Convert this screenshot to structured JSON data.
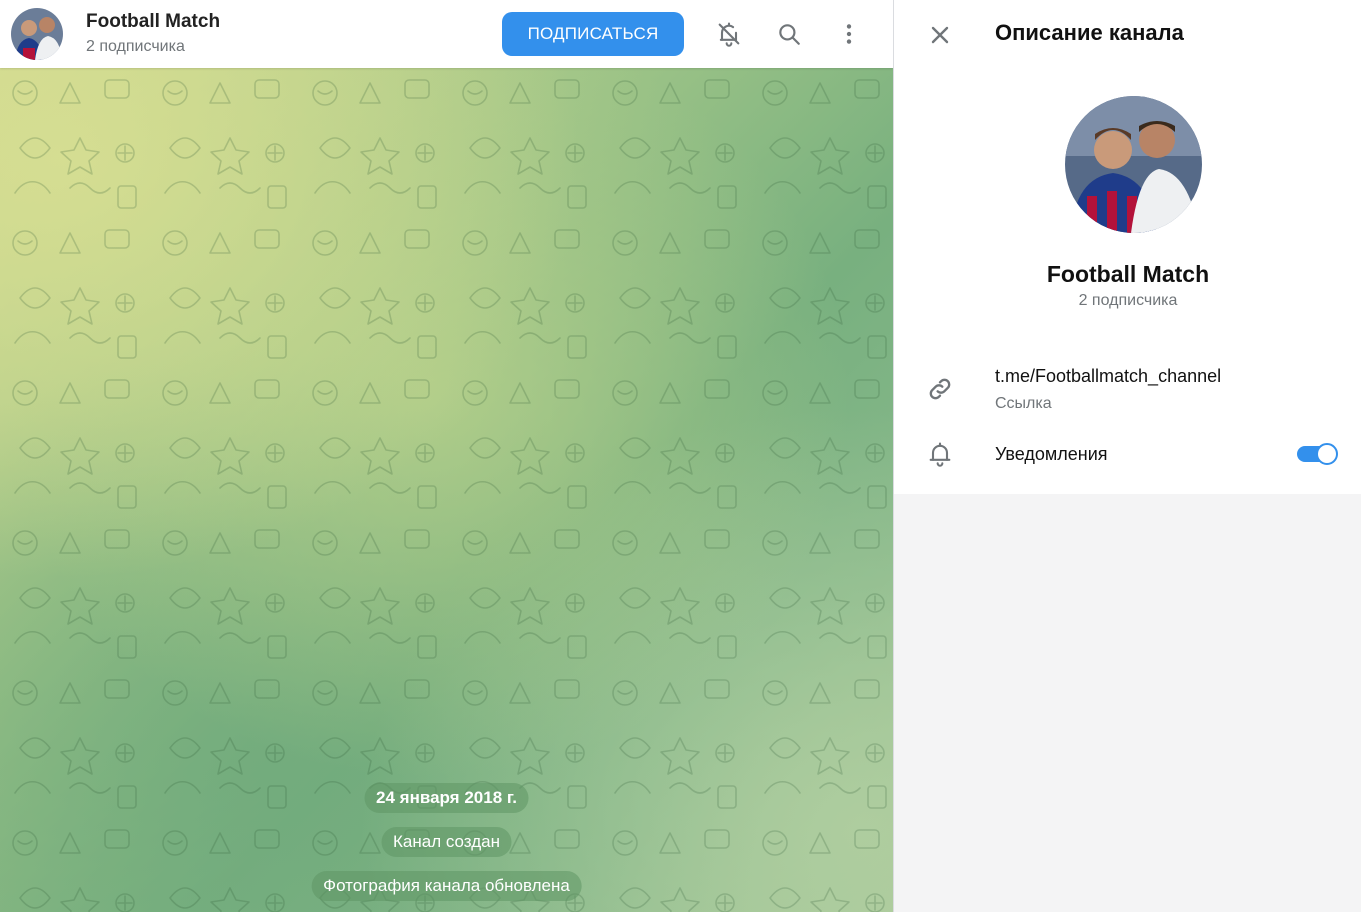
{
  "header": {
    "title": "Football Match",
    "subtitle": "2 подписчика",
    "subscribe_label": "ПОДПИСАТЬСЯ",
    "icons": [
      "bell-off-icon",
      "search-icon",
      "more-vertical-icon"
    ]
  },
  "messages": {
    "date": "24 января 2018 г.",
    "items": [
      "Канал создан",
      "Фотография канала обновлена"
    ]
  },
  "panel": {
    "title": "Описание канала",
    "name": "Football Match",
    "subscribers": "2 подписчика",
    "link": {
      "value": "t.me/Footballmatch_channel",
      "caption": "Ссылка"
    },
    "notifications": {
      "label": "Уведомления",
      "enabled": true
    }
  },
  "colors": {
    "accent": "#3390ec",
    "muted_text": "#707579",
    "panel_bg": "#f4f4f5"
  }
}
